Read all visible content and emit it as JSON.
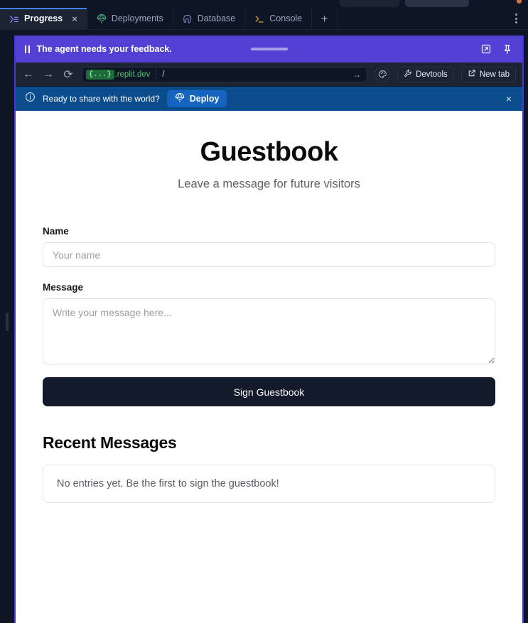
{
  "window": {
    "background_color": "#0e1525",
    "accent_purple": "#4b35d6"
  },
  "tabbar": {
    "tabs": [
      {
        "label": "Progress",
        "icon": "terminal-progress-icon",
        "active": true,
        "closable": true,
        "close_label": "×"
      },
      {
        "label": "Deployments",
        "icon": "parachute-icon",
        "active": false,
        "closable": false
      },
      {
        "label": "Database",
        "icon": "postgres-elephant-icon",
        "active": false,
        "closable": false
      },
      {
        "label": "Console",
        "icon": "console-prompt-icon",
        "active": false,
        "closable": false
      }
    ],
    "add_tab_label": "+",
    "more_options_label": "More options"
  },
  "agent_bar": {
    "status_text": "The agent needs your feedback.",
    "pause_icon": "pause-icon",
    "drag_handle": "drag-handle",
    "popout_icon": "open-external-icon",
    "pin_icon": "pin-icon",
    "background_color": "#5341d6"
  },
  "url_bar": {
    "back_label": "←",
    "forward_label": "→",
    "reload_label": "⟳",
    "url_badge": "{...}",
    "url_host": ".replit.dev",
    "url_path": "/",
    "go_label": "→",
    "palette_icon": "palette-icon",
    "devtools_label": "Devtools",
    "devtools_icon": "wrench-icon",
    "newtab_label": "New tab",
    "newtab_icon": "open-external-icon"
  },
  "deploy_bar": {
    "info_icon": "info-circle-icon",
    "message": "Ready to share with the world?",
    "deploy_label": "Deploy",
    "deploy_icon": "parachute-icon",
    "close_label": "×",
    "background_color": "#0b4c8c",
    "button_color": "#1565c0"
  },
  "page": {
    "title": "Guestbook",
    "subtitle": "Leave a message for future visitors",
    "form": {
      "name_label": "Name",
      "name_value": "",
      "name_placeholder": "Your name",
      "message_label": "Message",
      "message_value": "",
      "message_placeholder": "Write your message here...",
      "submit_label": "Sign Guestbook",
      "submit_color": "#131a2b"
    },
    "recent": {
      "heading": "Recent Messages",
      "empty_text": "No entries yet. Be the first to sign the guestbook!",
      "entries": []
    }
  }
}
